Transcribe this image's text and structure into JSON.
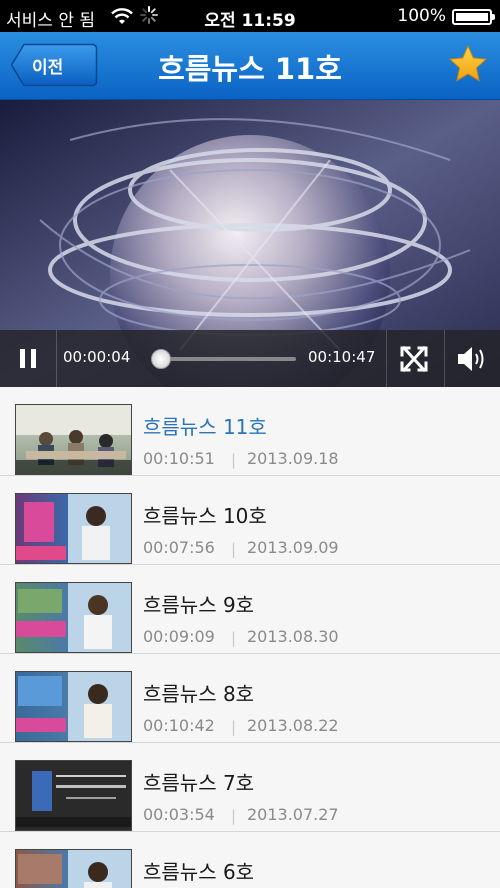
{
  "status_bar": {
    "carrier": "서비스 안 됨",
    "time": "오전 11:59",
    "battery": "100%"
  },
  "nav": {
    "back_label": "이전",
    "title": "흐름뉴스 11호",
    "star_icon": "star-icon",
    "accent": "#1a7ad4",
    "star_color": "#f5b21b"
  },
  "player": {
    "elapsed": "00:00:04",
    "duration": "00:10:47",
    "progress": 0.006,
    "pause_icon": "pause-icon",
    "fullscreen_icon": "fullscreen-icon",
    "volume_icon": "volume-icon"
  },
  "episodes": [
    {
      "title": "흐름뉴스 11호",
      "duration": "00:10:51",
      "date": "2013.09.18",
      "active": true
    },
    {
      "title": "흐름뉴스 10호",
      "duration": "00:07:56",
      "date": "2013.09.09",
      "active": false
    },
    {
      "title": "흐름뉴스 9호",
      "duration": "00:09:09",
      "date": "2013.08.30",
      "active": false
    },
    {
      "title": "흐름뉴스 8호",
      "duration": "00:10:42",
      "date": "2013.08.22",
      "active": false
    },
    {
      "title": "흐름뉴스 7호",
      "duration": "00:03:54",
      "date": "2013.07.27",
      "active": false
    },
    {
      "title": "흐름뉴스 6호",
      "duration": "",
      "date": "",
      "active": false
    }
  ],
  "divider": "|"
}
